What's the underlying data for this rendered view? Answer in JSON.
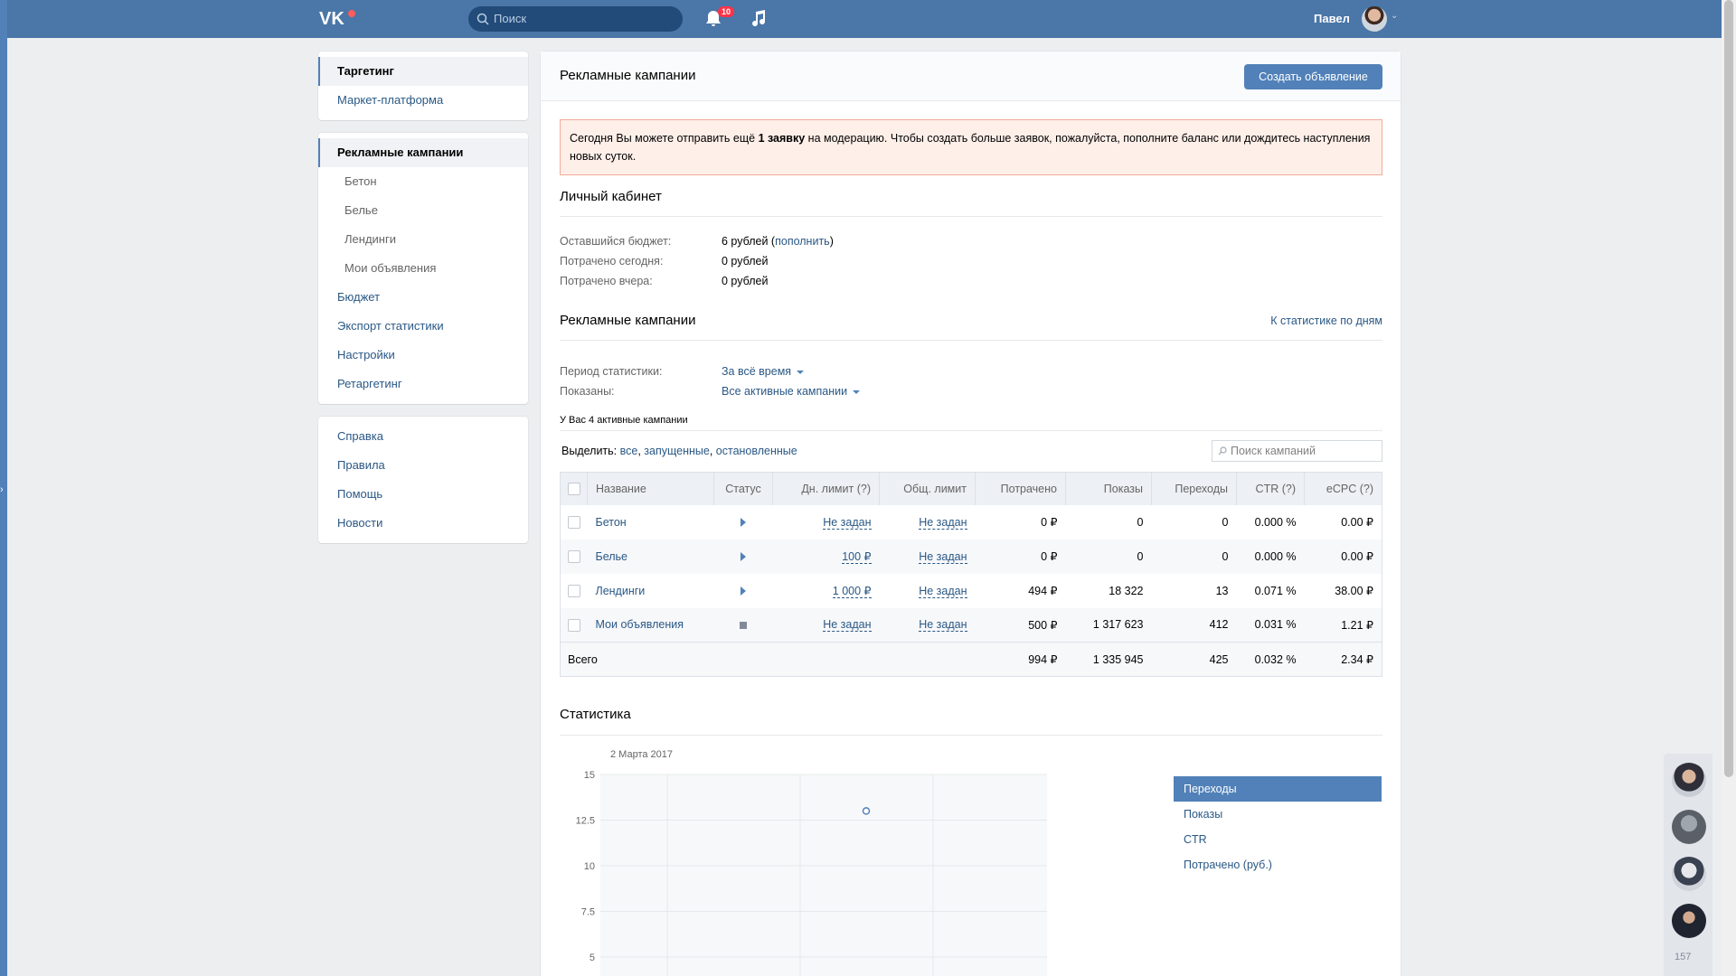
{
  "header": {
    "search_placeholder": "Поиск",
    "notifications_count": "10",
    "user_name": "Павел"
  },
  "left_menu": {
    "group1": [
      {
        "label": "Таргетинг",
        "active": true
      },
      {
        "label": "Маркет-платформа",
        "active": false
      }
    ],
    "group2": [
      {
        "label": "Рекламные кампании",
        "active": true,
        "sub": false
      },
      {
        "label": "Бетон",
        "sub": true
      },
      {
        "label": "Белье",
        "sub": true
      },
      {
        "label": "Лендинги",
        "sub": true
      },
      {
        "label": "Мои объявления",
        "sub": true
      },
      {
        "label": "Бюджет",
        "sub": false
      },
      {
        "label": "Экспорт статистики",
        "sub": false
      },
      {
        "label": "Настройки",
        "sub": false
      },
      {
        "label": "Ретаргетинг",
        "sub": false
      }
    ],
    "group3": [
      "Справка",
      "Правила",
      "Помощь",
      "Новости"
    ]
  },
  "main": {
    "title": "Рекламные кампании",
    "create_button": "Создать объявление",
    "alert": {
      "before": "Сегодня Вы можете отправить ещё ",
      "bold": "1 заявку",
      "after": " на модерацию. Чтобы создать больше заявок, пожалуйста, пополните баланс или дождитесь наступления новых суток."
    },
    "cabinet": {
      "title": "Личный кабинет",
      "budget_label": "Оставшийся бюджет:",
      "budget_value": "6 рублей",
      "topup_link": "пополнить",
      "today_label": "Потрачено сегодня:",
      "today_value": "0 рублей",
      "yesterday_label": "Потрачено вчера:",
      "yesterday_value": "0 рублей"
    },
    "campaigns": {
      "title": "Рекламные кампании",
      "stats_by_day_link": "К статистике по дням",
      "period_label": "Период статистики:",
      "period_value": "За всё время",
      "shown_label": "Показаны:",
      "shown_value": "Все активные кампании",
      "active_note": "У Вас 4 активные кампании",
      "select_label": "Выделить:",
      "select_all": "все",
      "select_running": "запущенные",
      "select_stopped": "остановленные",
      "search_placeholder": "Поиск кампаний",
      "columns": [
        "Название",
        "Статус",
        "Дн. лимит (?)",
        "Общ. лимит",
        "Потрачено",
        "Показы",
        "Переходы",
        "CTR (?)",
        "eCPC (?)"
      ],
      "rows": [
        {
          "name": "Бетон",
          "status": "running",
          "day_limit": "Не задан",
          "total_limit": "Не задан",
          "spent": "0 ₽",
          "shows": "0",
          "clicks": "0",
          "ctr": "0.000 %",
          "ecpc": "0.00 ₽"
        },
        {
          "name": "Белье",
          "status": "running",
          "day_limit": "100 ₽",
          "total_limit": "Не задан",
          "spent": "0 ₽",
          "shows": "0",
          "clicks": "0",
          "ctr": "0.000 %",
          "ecpc": "0.00 ₽"
        },
        {
          "name": "Лендинги",
          "status": "running",
          "day_limit": "1 000 ₽",
          "total_limit": "Не задан",
          "spent": "494 ₽",
          "shows": "18 322",
          "clicks": "13",
          "ctr": "0.071 %",
          "ecpc": "38.00 ₽"
        },
        {
          "name": "Мои объявления",
          "status": "stopped",
          "day_limit": "Не задан",
          "total_limit": "Не задан",
          "spent": "500 ₽",
          "shows": "1 317 623",
          "clicks": "412",
          "ctr": "0.031 %",
          "ecpc": "1.21 ₽"
        }
      ],
      "total": {
        "label": "Всего",
        "spent": "994 ₽",
        "shows": "1 335 945",
        "clicks": "425",
        "ctr": "0.032 %",
        "ecpc": "2.34 ₽"
      }
    },
    "statistics": {
      "title": "Статистика",
      "date_label": "2 Марта 2017",
      "legend": [
        "Переходы",
        "Показы",
        "CTR",
        "Потрачено (руб.)"
      ],
      "legend_active": "Переходы"
    }
  },
  "chart_data": {
    "type": "line",
    "title": "",
    "xlabel": "",
    "ylabel": "",
    "y_ticks": [
      "15",
      "12.5",
      "10",
      "7.5",
      "5"
    ],
    "ylim": [
      5,
      15
    ],
    "series": [
      {
        "name": "Переходы",
        "x": [
          "2 Марта 2017"
        ],
        "values": [
          13
        ]
      }
    ],
    "grid": true
  },
  "friends_online_count": "157",
  "colors": {
    "header": "#4a76a8",
    "accent": "#5181b8",
    "link": "#2a5885",
    "alert_bg": "#ffefe9",
    "alert_border": "#f2ab99"
  }
}
